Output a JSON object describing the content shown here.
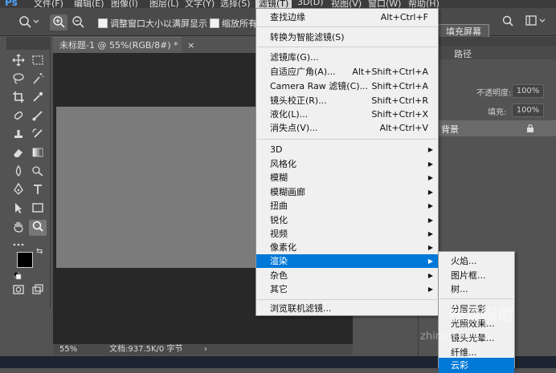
{
  "menubar": {
    "logo": "Ps",
    "items": [
      "文件(F)",
      "编辑(E)",
      "图像(I)",
      "图层(L)",
      "文字(Y)",
      "选择(S)",
      "滤镜(T)",
      "3D(D)",
      "视图(V)",
      "窗口(W)",
      "帮助(H)"
    ]
  },
  "options": {
    "resize_window_label": "调整窗口大小以满屏显示",
    "zoom_all_label": "缩放所有",
    "fill_screen_label": "填充屏幕"
  },
  "document": {
    "tab_title": "未标题-1 @ 55%(RGB/8#)",
    "tab_close": "×",
    "tab_modified": "*",
    "zoom": "55%",
    "doc_size": "文档:937.5K/0 字节",
    "status_arrow": "›"
  },
  "panels": {
    "paths_tab": "路径",
    "opacity_label": "不透明度:",
    "opacity_value": "100%",
    "fill_label": "填充:",
    "fill_value": "100%",
    "background_layer": "背景"
  },
  "filter_menu": {
    "items": [
      {
        "label": "查找边缘",
        "shortcut": "Alt+Ctrl+F"
      },
      {
        "label": "转换为智能滤镜(S)",
        "shortcut": ""
      },
      {
        "label": "滤镜库(G)...",
        "shortcut": ""
      },
      {
        "label": "自适应广角(A)...",
        "shortcut": "Alt+Shift+Ctrl+A"
      },
      {
        "label": "Camera Raw 滤镜(C)...",
        "shortcut": "Shift+Ctrl+A"
      },
      {
        "label": "镜头校正(R)...",
        "shortcut": "Shift+Ctrl+R"
      },
      {
        "label": "液化(L)...",
        "shortcut": "Shift+Ctrl+X"
      },
      {
        "label": "消失点(V)...",
        "shortcut": "Alt+Ctrl+V"
      },
      {
        "label": "3D",
        "shortcut": ""
      },
      {
        "label": "风格化",
        "shortcut": ""
      },
      {
        "label": "模糊",
        "shortcut": ""
      },
      {
        "label": "模糊画廊",
        "shortcut": ""
      },
      {
        "label": "扭曲",
        "shortcut": ""
      },
      {
        "label": "锐化",
        "shortcut": ""
      },
      {
        "label": "视频",
        "shortcut": ""
      },
      {
        "label": "像素化",
        "shortcut": ""
      },
      {
        "label": "渲染",
        "shortcut": ""
      },
      {
        "label": "杂色",
        "shortcut": ""
      },
      {
        "label": "其它",
        "shortcut": ""
      },
      {
        "label": "浏览联机滤镜...",
        "shortcut": ""
      }
    ],
    "highlighted": "渲染"
  },
  "render_submenu": {
    "items": [
      "火焰...",
      "图片框...",
      "树...",
      "分层云彩",
      "光照效果...",
      "镜头光晕...",
      "纤维...",
      "云彩"
    ],
    "highlighted": "云彩"
  },
  "watermark": {
    "line1": "快速指南",
    "line2": "zhinanle.com"
  },
  "icons": {
    "zoom_in": "+",
    "zoom_out": "−",
    "submenu_arrow": "▶",
    "lock": "🔒"
  },
  "colors": {
    "menu_highlight": "#0078d7",
    "ps_blue": "#4ea3ff"
  }
}
